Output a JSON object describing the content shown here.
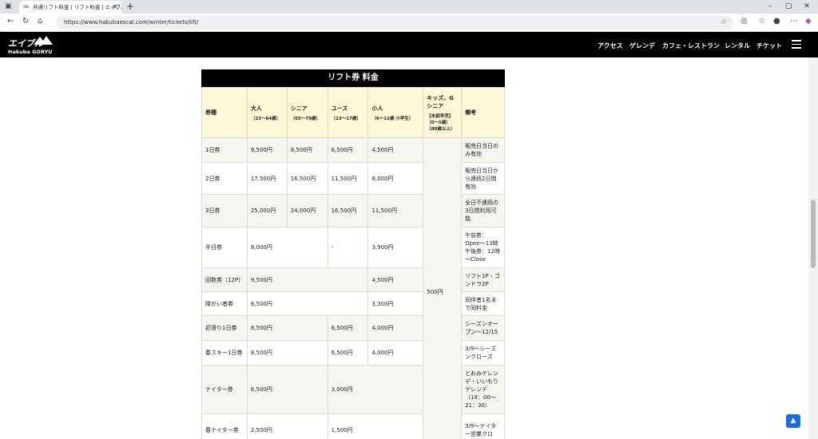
{
  "browser": {
    "tab_title": "共通リフト料金 | リフト料金 | エイブル",
    "favicon_text": "ABL",
    "url": "https://www.hakubaescal.com/winter/tickets/lift/"
  },
  "site": {
    "logo_main": "エイブル",
    "logo_sub": "Hakuba GORYU",
    "nav": [
      "アクセス",
      "ゲレンデ",
      "カフェ・レストラン",
      "レンタル",
      "チケット"
    ]
  },
  "table": {
    "title": "リフト券 料金",
    "headers": [
      {
        "label": "券種",
        "sub": ""
      },
      {
        "label": "大人",
        "sub": "（23～64歳）"
      },
      {
        "label": "シニア",
        "sub": "（65～79歳）"
      },
      {
        "label": "ユース",
        "sub": "（13～17歳）"
      },
      {
        "label": "小人",
        "sub": "（6～12歳 小学生）"
      },
      {
        "label": "キッズ、Gシニア",
        "sub": "【未就学児】（0～5歳）（80歳以上）"
      },
      {
        "label": "備考",
        "sub": ""
      }
    ],
    "kids_price": "500円",
    "rows": [
      {
        "name": "1日券",
        "adult": "9,500円",
        "senior": "8,500円",
        "youth": "6,500円",
        "child": "4,500円",
        "note": "販売日当日のみ有効"
      },
      {
        "name": "2日券",
        "adult": "17,500円",
        "senior": "16,500円",
        "youth": "11,500円",
        "child": "8,000円",
        "note": "販売日当日から連続2日間有効"
      },
      {
        "name": "3日券",
        "adult": "25,000円",
        "senior": "24,000円",
        "youth": "16,500円",
        "child": "11,500円",
        "note": "全日不連続の3日間利用可能"
      },
      {
        "name": "半日券",
        "adult": "8,000円",
        "youth": "-",
        "child": "3,900円",
        "note": "午前券：Open～13時 午後券：12時～Close"
      },
      {
        "name": "回数券（12P)",
        "adult": "9,500円",
        "child": "4,500円",
        "note": "リフト1P・ゴンドラ2P"
      },
      {
        "name": "障がい者券",
        "adult": "6,500円",
        "child": "3,300円",
        "note": "同伴者1名まで同料金"
      },
      {
        "name": "初滑り1日券",
        "adult": "8,500円",
        "youth": "6,500円",
        "child": "4,000円",
        "note": "シーズンオープン～12/15"
      },
      {
        "name": "春スキー1日券",
        "adult": "8,500円",
        "youth": "6,500円",
        "child": "4,000円",
        "note": "3/9～シーズンクローズ"
      },
      {
        "name": "ナイター券",
        "adult": "6,500円",
        "youth": "3,000円",
        "note": "とおみゲレンデ・いいもりゲレンデ（18：00～21：30）"
      },
      {
        "name": "春ナイター券",
        "adult": "2,500円",
        "youth": "1,500円",
        "note": "3/9～ナイター営業クロ"
      }
    ]
  },
  "icons": {
    "back_to_top": "arrow-up-icon",
    "menu": "hamburger-icon"
  }
}
